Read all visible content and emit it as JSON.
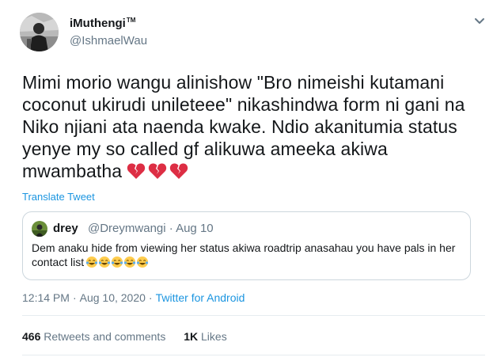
{
  "author": {
    "display_name": "iMuthengi",
    "trademark": "TM",
    "handle": "@IshmaelWau",
    "avatar_icon": "profile-photo-icon"
  },
  "tweet": {
    "text": "Mimi morio wangu alinishow \"Bro nimeishi kutamani coconut ukirudi unileteee\" nikashindwa form ni gani na Niko njiani ata naenda kwake. Ndio akanitumia status yenye my so called gf alikuwa ameeka akiwa mwambatha",
    "emoji": [
      "broken-heart-icon",
      "broken-heart-icon",
      "broken-heart-icon"
    ],
    "translate_label": "Translate Tweet"
  },
  "quoted": {
    "display_name": "drey",
    "handle_date": "@Dreymwangi · Aug 10",
    "text": "Dem anaku hide from viewing her status akiwa roadtrip anasahau you have pals in her contact list",
    "emoji": [
      "tears-of-joy-icon",
      "tears-of-joy-icon",
      "tears-of-joy-icon",
      "tears-of-joy-icon",
      "tears-of-joy-icon"
    ]
  },
  "meta": {
    "time": "12:14 PM",
    "date": "Aug 10, 2020",
    "separator": "·",
    "source": "Twitter for Android"
  },
  "stats": {
    "retweets_count": "466",
    "retweets_label": "Retweets and comments",
    "likes_count": "1K",
    "likes_label": "Likes"
  },
  "colors": {
    "link": "#1b95e0",
    "secondary_text": "#657786",
    "border": "#ccd6dd",
    "heart": "#dd2e44"
  }
}
